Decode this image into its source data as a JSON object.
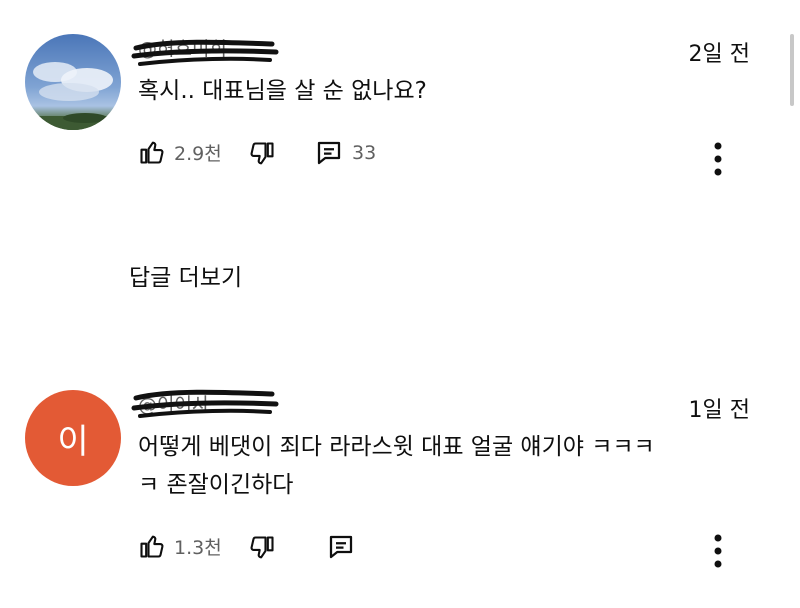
{
  "comments": [
    {
      "author": "@허호미희",
      "time": "2일 전",
      "text": "혹시.. 대표님을 살 순 없나요?",
      "likes": "2.9천",
      "replies_count": "33",
      "avatar_type": "sky-photo"
    },
    {
      "author": "@이어사",
      "avatar_letter": "이",
      "time": "1일 전",
      "text_line1": "어떻게 베댓이 죄다 라라스윗 대표 얼굴 얘기야 ㅋㅋㅋ",
      "text_line2": "ㅋ 존잘이긴하다",
      "likes": "1.3천",
      "avatar_color": "#e35a35"
    }
  ],
  "more_replies_label": "답글 더보기",
  "icons": [
    "like-icon",
    "dislike-icon",
    "reply-icon",
    "more-options-icon"
  ]
}
